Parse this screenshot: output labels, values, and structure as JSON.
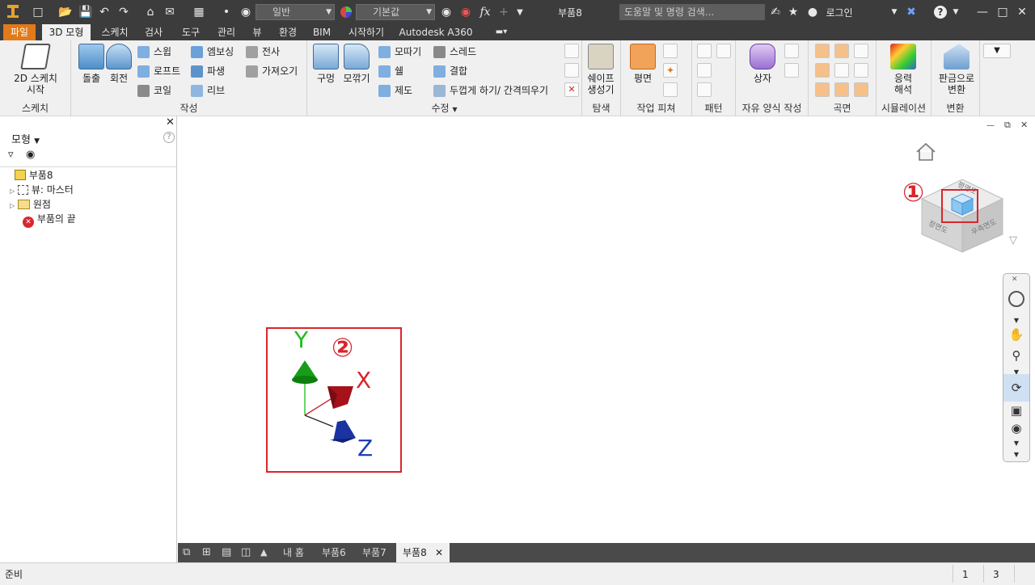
{
  "titlebar": {
    "style_combo": "일반",
    "material_combo": "기본값",
    "fx_icon": "fx",
    "doc_title": "부품8",
    "search_placeholder": "도움말 및 명령 검색...",
    "login_label": "로그인",
    "help_label": "?"
  },
  "tabs": [
    "파일",
    "3D 모형",
    "스케치",
    "검사",
    "도구",
    "관리",
    "뷰",
    "환경",
    "BIM",
    "시작하기",
    "Autodesk A360"
  ],
  "ribbon": {
    "sketch": {
      "button": "2D 스케치 시작",
      "line1": "2D 스케치",
      "line2": "시작",
      "label": "스케치"
    },
    "create": {
      "extrude": "돌출",
      "revolve": "회전",
      "sweep": "스윕",
      "loft": "로프트",
      "coil": "코일",
      "emboss": "엠보싱",
      "derive": "파생",
      "rib": "리브",
      "decal": "전사",
      "import": "가져오기",
      "label": "작성"
    },
    "modify": {
      "hole": "구멍",
      "fillet": "모깎기",
      "chamfer": "모따기",
      "shell": "쉘",
      "draft": "제도",
      "thread": "스레드",
      "combine": "결합",
      "thicken": "두껍게 하기/ 간격띄우기",
      "label": "수정"
    },
    "explore": {
      "shape_gen_line1": "쉐이프",
      "shape_gen_line2": "생성기",
      "label": "탐색"
    },
    "work_features": {
      "plane": "평면",
      "label": "작업 피쳐"
    },
    "pattern": {
      "label": "패턴"
    },
    "freeform": {
      "box": "상자",
      "label": "자유 양식 작성"
    },
    "surface": {
      "label": "곡면"
    },
    "simulation": {
      "stress_line1": "응력",
      "stress_line2": "해석",
      "label": "시뮬레이션"
    },
    "convert": {
      "sheetmetal_line1": "판금으로",
      "sheetmetal_line2": "변환",
      "label": "변환"
    }
  },
  "browser": {
    "header": "모형",
    "tree": [
      {
        "label": "부품8",
        "icon": "part-icon"
      },
      {
        "label": "뷰: 마스터",
        "icon": "view-icon"
      },
      {
        "label": "원점",
        "icon": "folder-icon"
      },
      {
        "label": "부품의 끝",
        "icon": "end-of-part-icon"
      }
    ]
  },
  "viewport": {
    "annotation1": "①",
    "annotation2": "②",
    "axis_x": "X",
    "axis_y": "Y",
    "axis_z": "Z",
    "viewcube_top": "평면도",
    "viewcube_front": "정면도",
    "viewcube_right": "우측면도"
  },
  "doctabs": [
    "내 홈",
    "부품6",
    "부품7",
    "부품8"
  ],
  "status": {
    "left": "준비",
    "n1": "1",
    "n2": "3"
  },
  "colors": {
    "accent_file": "#e07a1a",
    "annotation_red": "#d9252c",
    "axis_x": "#c0151b",
    "axis_y": "#1cbd1c",
    "axis_z": "#1f3fb3"
  }
}
